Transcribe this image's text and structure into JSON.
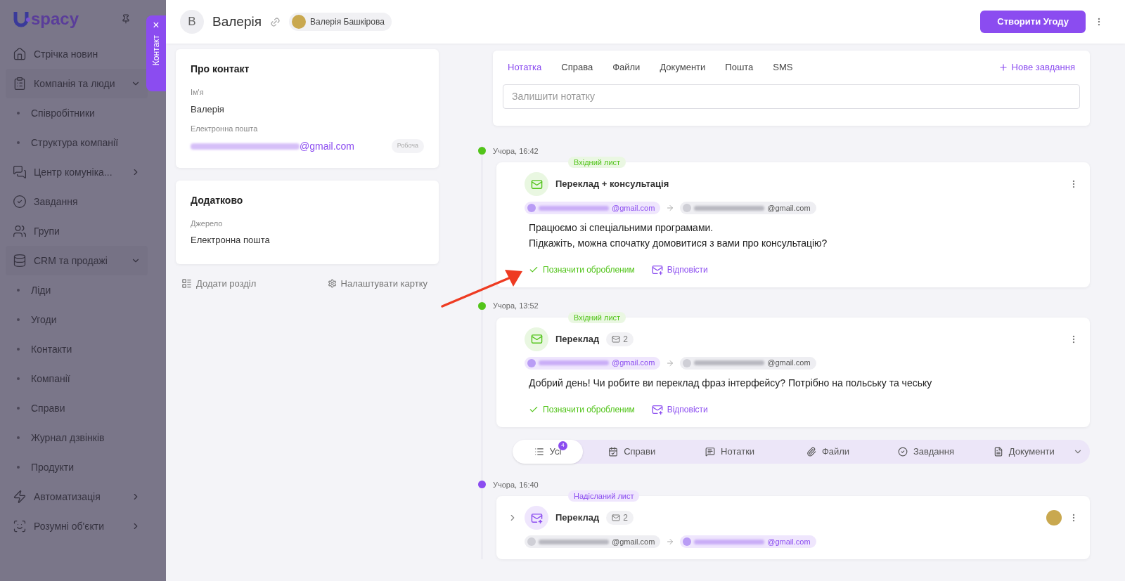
{
  "sidebar": {
    "logo": "spacy",
    "items": [
      {
        "label": "Стрічка новин"
      },
      {
        "label": "Компанія та люди",
        "expanded": true,
        "children": [
          {
            "label": "Співробітники"
          },
          {
            "label": "Структура компанії"
          }
        ]
      },
      {
        "label": "Центр комуніка...",
        "expanded": false
      },
      {
        "label": "Завдання"
      },
      {
        "label": "Групи"
      },
      {
        "label": "CRM та продажі",
        "expanded": true,
        "children": [
          {
            "label": "Ліди"
          },
          {
            "label": "Угоди"
          },
          {
            "label": "Контакти"
          },
          {
            "label": "Компанії"
          },
          {
            "label": "Справи"
          },
          {
            "label": "Журнал дзвінків"
          },
          {
            "label": "Продукти"
          }
        ]
      },
      {
        "label": "Автоматизація",
        "expanded": false
      },
      {
        "label": "Розумні об'єкти",
        "expanded": false
      }
    ]
  },
  "side_tab": {
    "label": "Контакт",
    "close": "×"
  },
  "header": {
    "initial": "В",
    "name": "Валерія",
    "owner": "Валерія Башкірова",
    "create_button": "Створити Угоду"
  },
  "cards": [
    {
      "title": "Про контакт",
      "fields": [
        {
          "label": "Ім'я",
          "value": "Валерія"
        },
        {
          "label": "Електронна пошта",
          "value": "@gmail.com",
          "tag": "Робоча"
        }
      ]
    },
    {
      "title": "Додатково",
      "fields": [
        {
          "label": "Джерело",
          "value": "Електронна пошта"
        }
      ]
    }
  ],
  "card_actions": [
    "Додати розділ",
    "Налаштувати картку"
  ],
  "composer": {
    "tabs": [
      {
        "label": "Нотатка",
        "selected": true
      },
      {
        "label": "Справа",
        "selected": false
      },
      {
        "label": "Файли",
        "selected": false
      },
      {
        "label": "Документи",
        "selected": false
      },
      {
        "label": "Пошта",
        "selected": false
      },
      {
        "label": "SMS",
        "selected": false
      }
    ],
    "new_task": "Нове завдання",
    "placeholder": "Залишити нотатку"
  },
  "timeline": [
    {
      "kind": "incoming",
      "time": "Учора, 16:42",
      "color": "#52c41a",
      "badge": "Вхідний лист",
      "subject": "Переклад + консультація",
      "from": "@gmail.com",
      "to": "@gmail.com",
      "body": [
        "Працюємо зі спеціальними програмами.",
        "Підкажіть, можна спочатку домовитися з вами про консультацію?"
      ],
      "actions": [
        "Позначити обробленим",
        "Відповісти"
      ]
    },
    {
      "kind": "incoming",
      "time": "Учора, 13:52",
      "color": "#52c41a",
      "badge": "Вхідний лист",
      "subject": "Переклад",
      "count": "2",
      "from": "@gmail.com",
      "to": "@gmail.com",
      "body": [
        "Добрий день! Чи робите ви переклад фраз інтерфейсу? Потрібно на польську та чеську"
      ],
      "actions": [
        "Позначити обробленим",
        "Відповісти"
      ]
    }
  ],
  "filters": [
    {
      "label": "Усі",
      "selected": true,
      "count": "4"
    },
    {
      "label": "Справи",
      "selected": false
    },
    {
      "label": "Нотатки",
      "selected": false
    },
    {
      "label": "Файли",
      "selected": false
    },
    {
      "label": "Завдання",
      "selected": false
    },
    {
      "label": "Документи",
      "selected": false
    }
  ],
  "timeline_after": [
    {
      "kind": "sent",
      "time": "Учора, 16:40",
      "color": "#8b4cf0",
      "badge": "Надісланий лист",
      "subject": "Переклад",
      "count": "2",
      "from": "@gmail.com",
      "to": "@gmail.com",
      "expanded": false
    }
  ]
}
